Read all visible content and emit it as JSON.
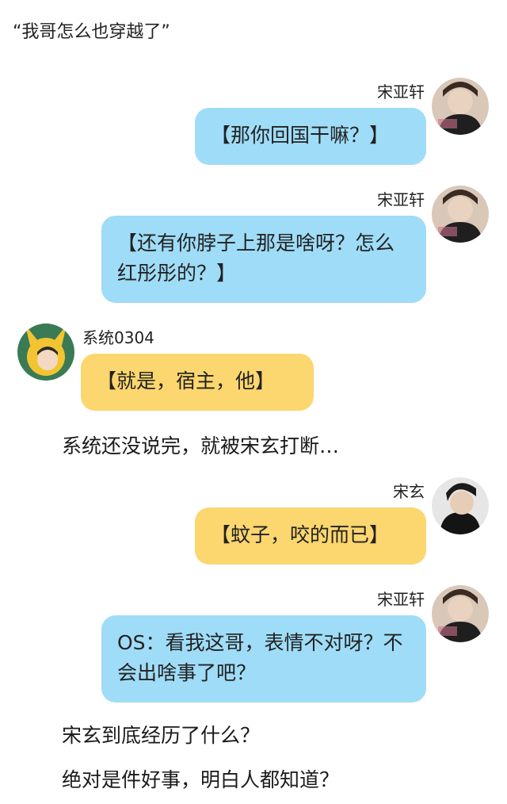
{
  "title": "“我哥怎么也穿越了”",
  "messages": [
    {
      "sender": "宋亚轩",
      "side": "right",
      "color": "blue",
      "text": "【那你回国干嘛？】"
    },
    {
      "sender": "宋亚轩",
      "side": "right",
      "color": "blue",
      "text": "【还有你脖子上那是啥呀？怎么红彤彤的？】"
    },
    {
      "sender": "系统0304",
      "side": "left",
      "color": "yellow",
      "text": "【就是，宿主，他】"
    },
    {
      "sender": "宋玄",
      "side": "right",
      "color": "yellow",
      "text": "【蚊子，咬的而已】"
    },
    {
      "sender": "宋亚轩",
      "side": "right",
      "color": "blue",
      "text": "OS：看我这哥，表情不对呀？不会出啥事了吧？"
    }
  ],
  "narration": [
    "系统还没说完，就被宋玄打断…",
    "宋玄到底经历了什么？",
    "绝对是件好事，明白人都知道？"
  ],
  "colors": {
    "blue_bubble": "#9fdcf7",
    "yellow_bubble": "#fcd66f"
  }
}
